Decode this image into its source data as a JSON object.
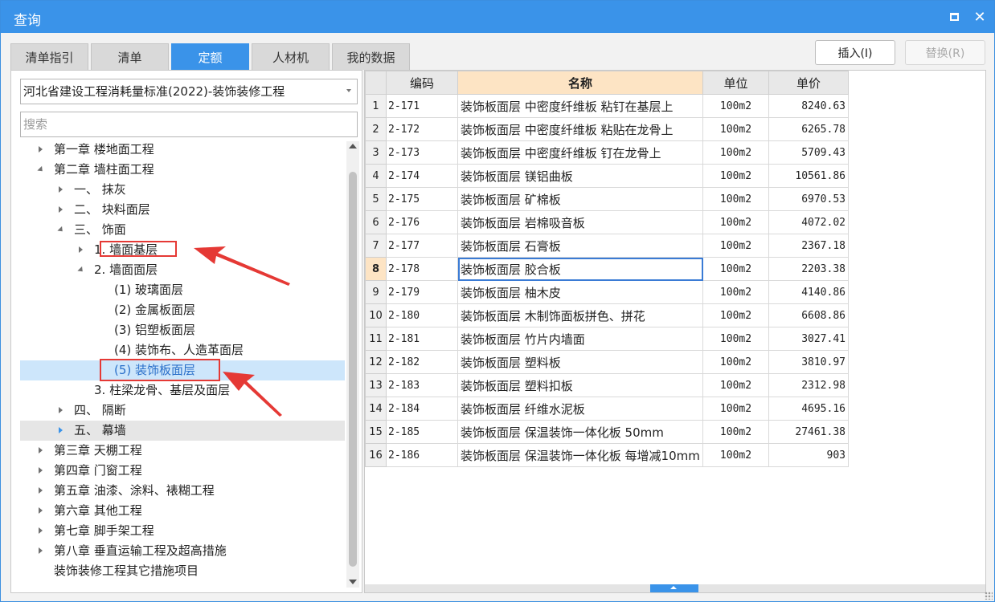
{
  "window": {
    "title": "查询"
  },
  "tabs": [
    {
      "label": "清单指引",
      "active": false
    },
    {
      "label": "清单",
      "active": false
    },
    {
      "label": "定额",
      "active": true
    },
    {
      "label": "人材机",
      "active": false
    },
    {
      "label": "我的数据",
      "active": false
    }
  ],
  "buttons": {
    "insert": "插入(I)",
    "replace": "替换(R)"
  },
  "left": {
    "library": "河北省建设工程消耗量标准(2022)-装饰装修工程",
    "search_placeholder": "搜索",
    "tree": [
      {
        "label": "第一章 楼地面工程",
        "level": 0,
        "state": "collapsed"
      },
      {
        "label": "第二章 墙柱面工程",
        "level": 0,
        "state": "expanded"
      },
      {
        "label": "一、 抹灰",
        "level": 1,
        "state": "collapsed"
      },
      {
        "label": "二、 块料面层",
        "level": 1,
        "state": "collapsed"
      },
      {
        "label": "三、 饰面",
        "level": 1,
        "state": "expanded"
      },
      {
        "label": "1. 墙面基层",
        "level": 2,
        "state": "collapsed",
        "highlighted": true
      },
      {
        "label": "2. 墙面面层",
        "level": 2,
        "state": "expanded"
      },
      {
        "label": "(1) 玻璃面层",
        "level": 3,
        "state": "leaf"
      },
      {
        "label": "(2) 金属板面层",
        "level": 3,
        "state": "leaf"
      },
      {
        "label": "(3) 铝塑板面层",
        "level": 3,
        "state": "leaf"
      },
      {
        "label": "(4) 装饰布、人造革面层",
        "level": 3,
        "state": "leaf"
      },
      {
        "label": "(5) 装饰板面层",
        "level": 3,
        "state": "leaf",
        "selected": true,
        "highlighted": true
      },
      {
        "label": "3. 柱梁龙骨、基层及面层",
        "level": 2,
        "state": "leaf"
      },
      {
        "label": "四、 隔断",
        "level": 1,
        "state": "collapsed"
      },
      {
        "label": "五、 幕墙",
        "level": 1,
        "state": "collapsed",
        "hover": true
      },
      {
        "label": "第三章 天棚工程",
        "level": 0,
        "state": "collapsed"
      },
      {
        "label": "第四章 门窗工程",
        "level": 0,
        "state": "collapsed"
      },
      {
        "label": "第五章 油漆、涂料、裱糊工程",
        "level": 0,
        "state": "collapsed"
      },
      {
        "label": "第六章 其他工程",
        "level": 0,
        "state": "collapsed"
      },
      {
        "label": "第七章 脚手架工程",
        "level": 0,
        "state": "collapsed"
      },
      {
        "label": "第八章 垂直运输工程及超高措施",
        "level": 0,
        "state": "collapsed"
      },
      {
        "label": "装饰装修工程其它措施项目",
        "level": 0,
        "state": "leaf"
      }
    ]
  },
  "grid": {
    "headers": {
      "code": "编码",
      "name": "名称",
      "unit": "单位",
      "price": "单价"
    },
    "current_row": 8,
    "rows": [
      {
        "no": "1",
        "code": "2-171",
        "name": "装饰板面层 中密度纤维板 粘钉在基层上",
        "unit": "100m2",
        "price": "8240.63"
      },
      {
        "no": "2",
        "code": "2-172",
        "name": "装饰板面层 中密度纤维板 粘贴在龙骨上",
        "unit": "100m2",
        "price": "6265.78"
      },
      {
        "no": "3",
        "code": "2-173",
        "name": "装饰板面层 中密度纤维板 钉在龙骨上",
        "unit": "100m2",
        "price": "5709.43"
      },
      {
        "no": "4",
        "code": "2-174",
        "name": "装饰板面层 镁铝曲板",
        "unit": "100m2",
        "price": "10561.86"
      },
      {
        "no": "5",
        "code": "2-175",
        "name": "装饰板面层 矿棉板",
        "unit": "100m2",
        "price": "6970.53"
      },
      {
        "no": "6",
        "code": "2-176",
        "name": "装饰板面层 岩棉吸音板",
        "unit": "100m2",
        "price": "4072.02"
      },
      {
        "no": "7",
        "code": "2-177",
        "name": "装饰板面层 石膏板",
        "unit": "100m2",
        "price": "2367.18"
      },
      {
        "no": "8",
        "code": "2-178",
        "name": "装饰板面层 胶合板",
        "unit": "100m2",
        "price": "2203.38"
      },
      {
        "no": "9",
        "code": "2-179",
        "name": "装饰板面层 柚木皮",
        "unit": "100m2",
        "price": "4140.86"
      },
      {
        "no": "10",
        "code": "2-180",
        "name": "装饰板面层 木制饰面板拼色、拼花",
        "unit": "100m2",
        "price": "6608.86"
      },
      {
        "no": "11",
        "code": "2-181",
        "name": "装饰板面层 竹片内墙面",
        "unit": "100m2",
        "price": "3027.41"
      },
      {
        "no": "12",
        "code": "2-182",
        "name": "装饰板面层 塑料板",
        "unit": "100m2",
        "price": "3810.97"
      },
      {
        "no": "13",
        "code": "2-183",
        "name": "装饰板面层 塑料扣板",
        "unit": "100m2",
        "price": "2312.98"
      },
      {
        "no": "14",
        "code": "2-184",
        "name": "装饰板面层 纤维水泥板",
        "unit": "100m2",
        "price": "4695.16"
      },
      {
        "no": "15",
        "code": "2-185",
        "name": "装饰板面层 保温装饰一体化板 50mm",
        "unit": "100m2",
        "price": "27461.38"
      },
      {
        "no": "16",
        "code": "2-186",
        "name": "装饰板面层 保温装饰一体化板 每增减10mm",
        "unit": "100m2",
        "price": "903"
      }
    ]
  },
  "colors": {
    "accent": "#3a93e9",
    "annotation": "#e53935",
    "header_highlight": "#fde4c4"
  }
}
